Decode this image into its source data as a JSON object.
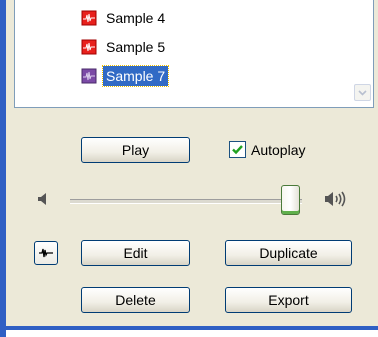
{
  "list": {
    "items": [
      {
        "label": "Sample 4",
        "icon": "red-audio-file-icon",
        "selected": false
      },
      {
        "label": "Sample 5",
        "icon": "red-audio-file-icon",
        "selected": false
      },
      {
        "label": "Sample 7",
        "icon": "purple-audio-file-icon",
        "selected": true
      }
    ]
  },
  "controls": {
    "play_label": "Play",
    "autoplay_label": "Autoplay",
    "autoplay_checked": true,
    "volume_level": 0.95,
    "edit_label": "Edit",
    "duplicate_label": "Duplicate",
    "delete_label": "Delete",
    "export_label": "Export"
  },
  "colors": {
    "accent_blue": "#2f5fc4",
    "selection": "#316ac5",
    "check_green": "#21a121",
    "panel_bg": "#ece9d8"
  }
}
